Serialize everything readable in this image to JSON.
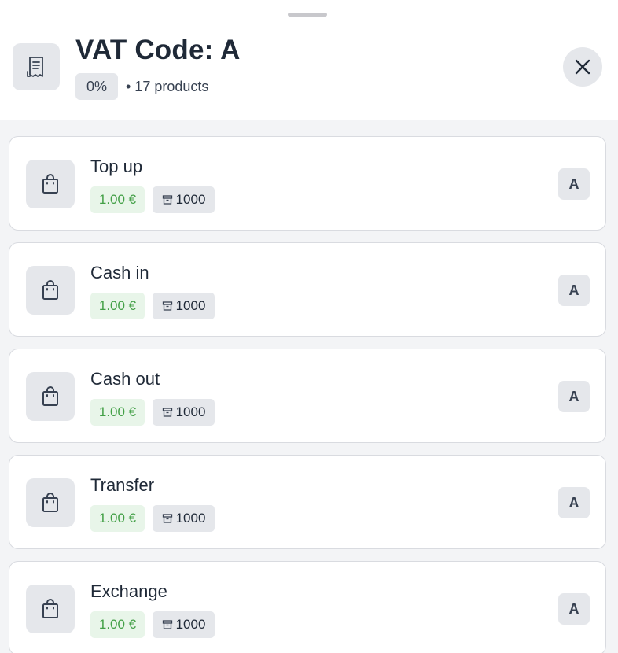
{
  "header": {
    "title": "VAT Code: A",
    "rate": "0%",
    "products_count": "• 17 products",
    "icon": "receipt-icon",
    "close_icon": "close-icon"
  },
  "products": [
    {
      "name": "Top up",
      "price": "1.00 €",
      "stock": "1000",
      "vat_code": "A"
    },
    {
      "name": "Cash in",
      "price": "1.00 €",
      "stock": "1000",
      "vat_code": "A"
    },
    {
      "name": "Cash out",
      "price": "1.00 €",
      "stock": "1000",
      "vat_code": "A"
    },
    {
      "name": "Transfer",
      "price": "1.00 €",
      "stock": "1000",
      "vat_code": "A"
    },
    {
      "name": "Exchange",
      "price": "1.00 €",
      "stock": "1000",
      "vat_code": "A"
    }
  ],
  "colors": {
    "price_text": "#43a047",
    "price_bg": "#e8f5e9",
    "badge_bg": "#e5e7eb",
    "card_border": "#d9dbe0"
  }
}
